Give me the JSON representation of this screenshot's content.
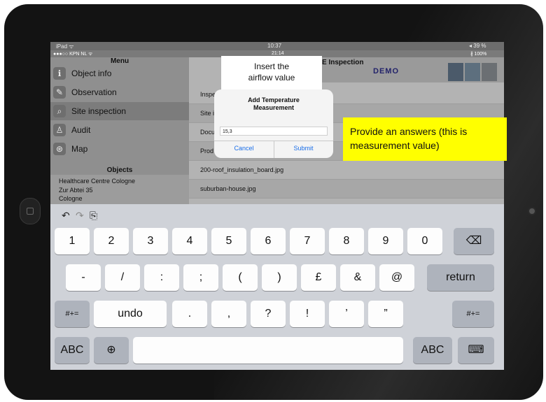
{
  "status": {
    "outer_left": "iPad ᯤ",
    "outer_time": "10:37",
    "outer_right": "◂ 39 %",
    "inner_left": "●●●○○ KPN NL ᯤ",
    "inner_time": "21:14",
    "inner_right": "∦ 100%"
  },
  "sidebar": {
    "title": "Menu",
    "items": [
      {
        "label": "Object info",
        "icon": "info-icon"
      },
      {
        "label": "Observation",
        "icon": "pencil-icon"
      },
      {
        "label": "Site inspection",
        "icon": "magnifier-icon"
      },
      {
        "label": "Audit",
        "icon": "audit-icon"
      },
      {
        "label": "Map",
        "icon": "map-icon"
      }
    ],
    "objects_title": "Objects",
    "object": {
      "line1": "Healthcare Centre Cologne",
      "line2": "Zur Abtei 35",
      "line3": "Cologne"
    }
  },
  "main": {
    "title": "E Inspection",
    "brand": "DEMO",
    "rows": [
      "Inspe",
      "Site i",
      "Docu",
      "Prod",
      "200-roof_insulation_board.jpg",
      "suburban-house.jpg"
    ]
  },
  "dialog": {
    "title_line1": "Add Temperature",
    "title_line2": "Measurement",
    "input_value": "15,3",
    "cancel": "Cancel",
    "submit": "Submit"
  },
  "callouts": {
    "insert_line1": "Insert the",
    "insert_line2": "airflow value",
    "answer_line1": "Provide an answers (this is",
    "answer_line2": "measurement value)"
  },
  "keyboard": {
    "toolbar": {
      "undo": "↶",
      "redo": "↷",
      "paste": "⎘"
    },
    "row1": [
      "1",
      "2",
      "3",
      "4",
      "5",
      "6",
      "7",
      "8",
      "9",
      "0"
    ],
    "backspace": "⌫",
    "row2": [
      "-",
      "/",
      ":",
      ";",
      "(",
      ")",
      "£",
      "&",
      "@"
    ],
    "return": "return",
    "symbols": "#+=",
    "undo": "undo",
    "row3": [
      ".",
      ",",
      "?",
      "!",
      "’",
      "”"
    ],
    "abc": "ABC",
    "globe": "⊕",
    "hide_keyboard": "⌨"
  }
}
